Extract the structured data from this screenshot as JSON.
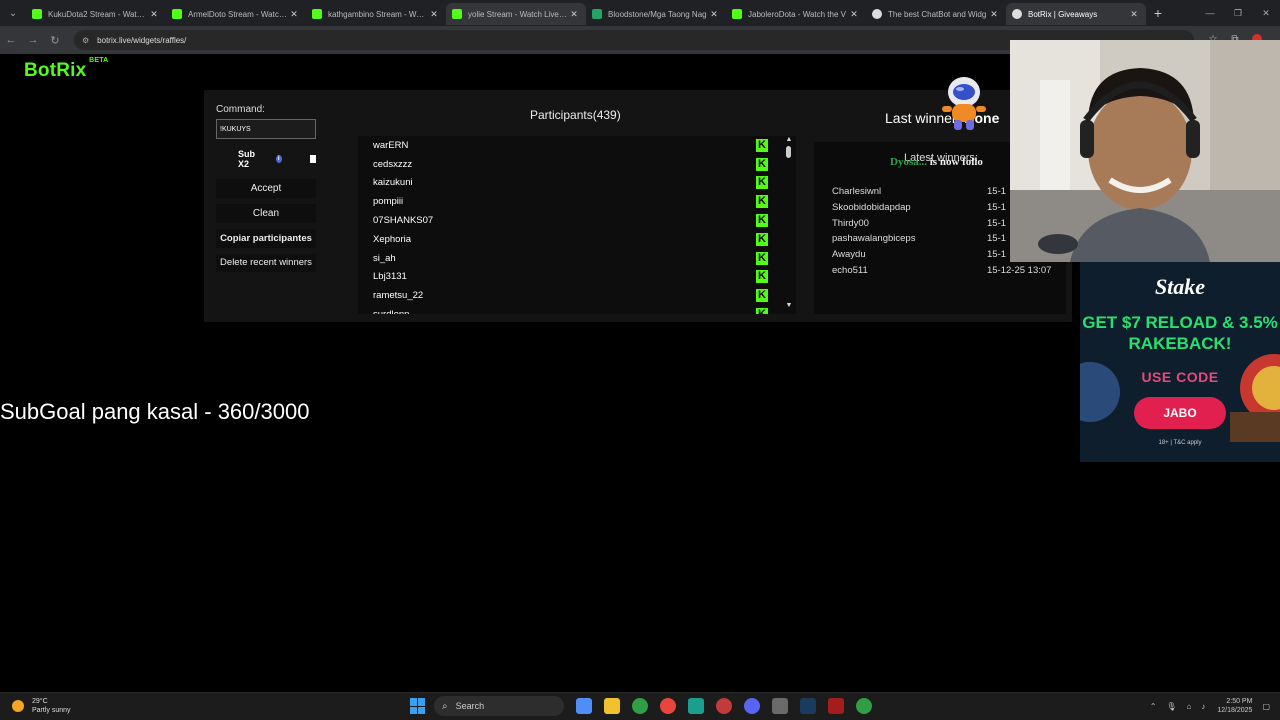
{
  "browser": {
    "tabs": [
      {
        "title": "KukuDota2 Stream - Watch Live",
        "favicon": "kick",
        "state": "normal"
      },
      {
        "title": "ArmelDoto Stream - Watch Live",
        "favicon": "kick",
        "state": "normal"
      },
      {
        "title": "kathgambino Stream - Watch Live",
        "favicon": "kick",
        "state": "normal"
      },
      {
        "title": "yolie Stream - Watch Live on Kick",
        "favicon": "kick",
        "state": "hover"
      },
      {
        "title": "Bloodstone/Mga Taong Nag",
        "favicon": "sheet",
        "state": "normal"
      },
      {
        "title": "JaboleroDota - Watch the V",
        "favicon": "kick",
        "state": "normal"
      },
      {
        "title": "The best ChatBot and Widg",
        "favicon": "gen",
        "state": "normal"
      },
      {
        "title": "BotRix | Giveaways",
        "favicon": "gen",
        "state": "active"
      }
    ],
    "url": "botrix.live/widgets/raffles/"
  },
  "app": {
    "logo": "BotRix",
    "logo_badge": "BETA"
  },
  "raffle": {
    "command_label": "Command:",
    "command_value": "!KUKUYS",
    "sub_label": "Sub X2",
    "buttons": {
      "accept": "Accept",
      "clean": "Clean",
      "copy": "Copiar participantes",
      "delete": "Delete recent winners"
    },
    "participants_title": "Participants(439)",
    "participants": [
      "warERN",
      "cedsxzzz",
      "kaizukuni",
      "pompiii",
      "07SHANKS07",
      "Xephoria",
      "si_ah",
      "Lbj3131",
      "rametsu_22",
      "surdlenn"
    ],
    "platform_glyph": "K"
  },
  "winners": {
    "last_winner_label": "Last winner:",
    "last_winner_value": "None",
    "latest_label": "Latest winners:",
    "follow_user": "Dyosa...",
    "follow_text": "is now follo",
    "list": [
      {
        "name": "Charlesiwnl",
        "date": "15-1"
      },
      {
        "name": "Skoobidobidapdap",
        "date": "15-1"
      },
      {
        "name": "Thirdy00",
        "date": "15-1"
      },
      {
        "name": "pashawalangbiceps",
        "date": "15-1"
      },
      {
        "name": "Awaydu",
        "date": "15-1"
      },
      {
        "name": "echo511",
        "date": "15-12-25 13:07"
      }
    ]
  },
  "subgoal": "SubGoal pang kasal - 360/3000",
  "ad": {
    "brand": "Stake",
    "promo": "GET $7 RELOAD & 3.5% RAKEBACK!",
    "use_code_label": "USE CODE",
    "code": "JABO",
    "terms": "18+ | T&C apply"
  },
  "taskbar": {
    "temperature": "29°C",
    "condition": "Partly sunny",
    "search_placeholder": "Search",
    "time": "2:50 PM",
    "date": "12/18/2025"
  },
  "colors": {
    "accent_green": "#53fc18",
    "ad_green": "#27e06f",
    "ad_pink": "#e2204f"
  }
}
